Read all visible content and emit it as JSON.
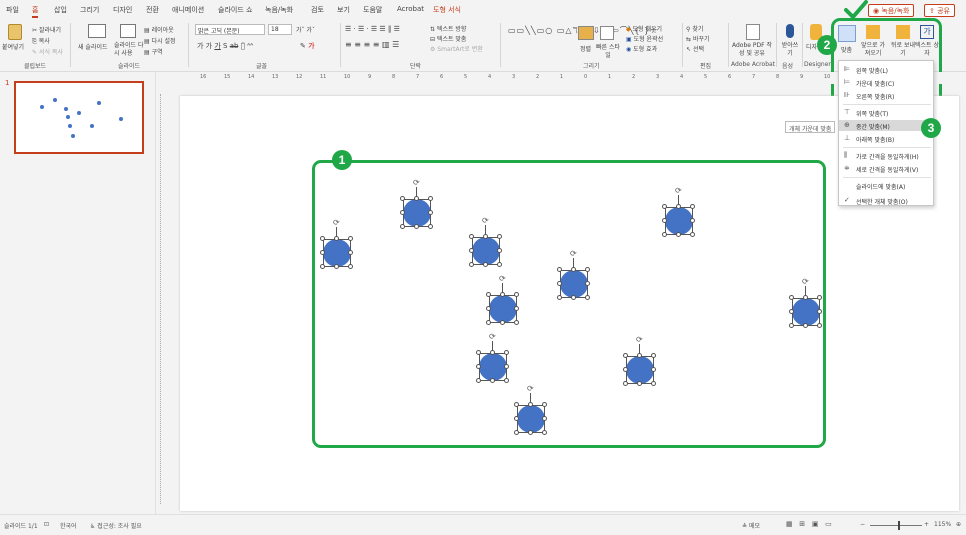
{
  "menubar": {
    "tabs": [
      "파일",
      "홈",
      "삽입",
      "그리기",
      "디자인",
      "전환",
      "애니메이션",
      "슬라이드 쇼",
      "녹음/녹화",
      "검토",
      "보기",
      "도움말",
      "Acrobat",
      "도형 서식"
    ],
    "record_label": "녹음/녹화",
    "share_label": "공유"
  },
  "ribbon": {
    "clipboard": {
      "paste": "붙여넣기",
      "cut": "잘라내기",
      "copy": "복사",
      "format_painter": "서식 복사",
      "group": "클립보드"
    },
    "slides": {
      "new_slide": "새 슬라이드",
      "reuse": "슬라이드 다시 사용",
      "layout": "레이아웃",
      "reset": "다시 설정",
      "section": "구역",
      "group": "슬라이드"
    },
    "font": {
      "name": "맑은 고딕 (본문)",
      "size": "18",
      "group": "글꼴"
    },
    "paragraph": {
      "text_direction": "텍스트 방향",
      "align_text": "텍스트 맞춤",
      "smartart": "SmartArt로 변환",
      "group": "단락"
    },
    "drawing": {
      "arrange": "정렬",
      "quick_styles": "빠른 스타일",
      "fill": "도형 채우기",
      "outline": "도형 윤곽선",
      "effects": "도형 효과",
      "group": "그리기"
    },
    "editing": {
      "find": "찾기",
      "replace": "바꾸기",
      "select": "선택",
      "group": "편집"
    },
    "acrobat": {
      "create": "Adobe PDF 작성 및 공유",
      "group": "Adobe Acrobat"
    },
    "voice": {
      "dictate": "받아쓰기",
      "group": "음성"
    },
    "designer": {
      "label": "디자인 아이디어",
      "group": "Designer"
    },
    "arrange2": {
      "align": "맞춤",
      "bring_forward": "앞으로 가져오기",
      "send_backward": "뒤로 보내기",
      "text_box": "텍스트 상자"
    }
  },
  "ruler": {
    "ticks": [
      "16",
      "15",
      "14",
      "13",
      "12",
      "11",
      "10",
      "9",
      "8",
      "7",
      "6",
      "5",
      "4",
      "3",
      "2",
      "1",
      "0",
      "1",
      "2",
      "3",
      "4",
      "5",
      "6",
      "7",
      "8",
      "9",
      "10",
      "11",
      "12"
    ]
  },
  "thumbs": {
    "slide_number": "1"
  },
  "tooltip": "개체 가운데 맞춤",
  "align_menu": {
    "items": [
      {
        "icon": "align-left-icon",
        "glyph": "⊫",
        "label": "왼쪽 맞춤(L)"
      },
      {
        "icon": "align-center-icon",
        "glyph": "⊨",
        "label": "가운데 맞춤(C)"
      },
      {
        "icon": "align-right-icon",
        "glyph": "⊪",
        "label": "오른쪽 맞춤(R)"
      },
      {
        "icon": "align-top-icon",
        "glyph": "⊤",
        "label": "위쪽 맞춤(T)"
      },
      {
        "icon": "align-middle-icon",
        "glyph": "⊕",
        "label": "중간 맞춤(M)"
      },
      {
        "icon": "align-bottom-icon",
        "glyph": "⊥",
        "label": "아래쪽 맞춤(B)"
      },
      {
        "icon": "distribute-horizontal-icon",
        "glyph": "⫼",
        "label": "가로 간격을 동일하게(H)"
      },
      {
        "icon": "distribute-vertical-icon",
        "glyph": "≑",
        "label": "세로 간격을 동일하게(V)"
      },
      {
        "icon": "blank-icon",
        "glyph": "",
        "label": "슬라이드에 맞춤(A)"
      },
      {
        "icon": "check-icon",
        "glyph": "✓",
        "label": "선택한 개체 맞춤(O)"
      }
    ]
  },
  "badges": [
    "1",
    "2",
    "3"
  ],
  "status": {
    "slide_count": "슬라이드 1/1",
    "language": "한국어",
    "accessibility": "접근성: 조사 필요",
    "notes": "메모",
    "zoom": "115%"
  },
  "colors": {
    "accent": "#c43e1c",
    "annotation": "#20a848",
    "shape_fill": "#4472c4"
  }
}
